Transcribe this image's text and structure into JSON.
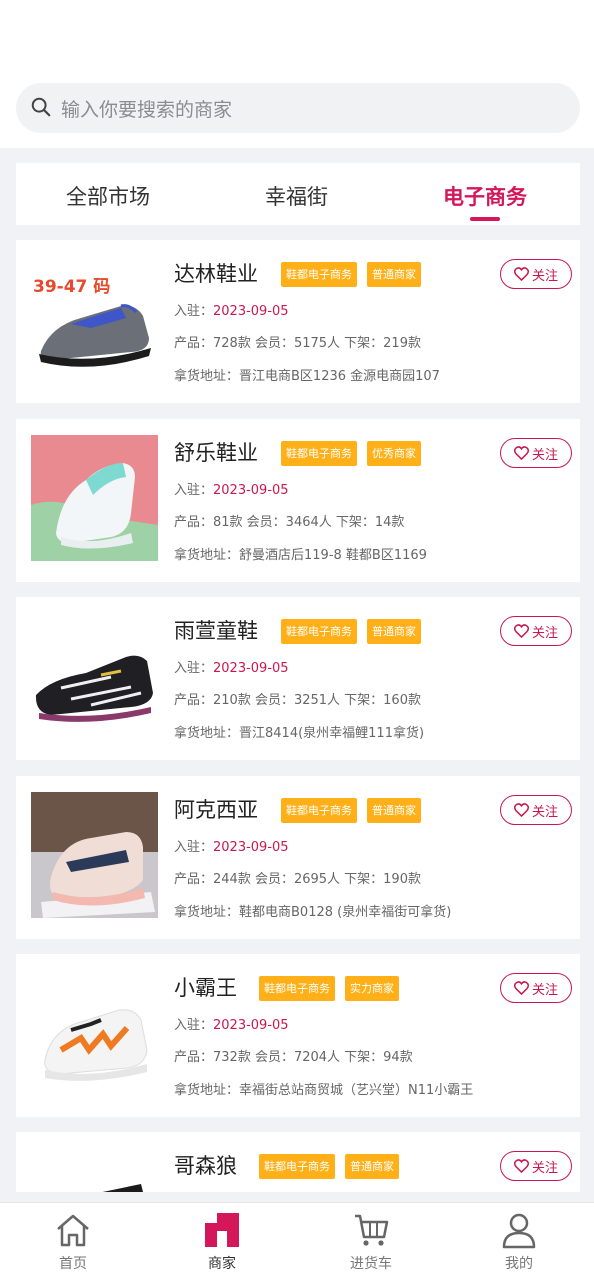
{
  "search": {
    "placeholder": "输入你要搜索的商家"
  },
  "tabs": [
    {
      "label": "全部市场",
      "active": false
    },
    {
      "label": "幸福街",
      "active": false
    },
    {
      "label": "电子商务",
      "active": true
    }
  ],
  "colors": {
    "accent": "#d31759",
    "tag": "#ffb019",
    "page_bg": "#f1f2f6"
  },
  "merchants": [
    {
      "name": "达林鞋业",
      "tags": [
        "鞋都电子商务",
        "普通商家"
      ],
      "follow": "关注",
      "join_label": "入驻：",
      "join_date": "2023-09-05",
      "stats": "产品：728款  会员：5175人  下架：219款",
      "address": "拿货地址：晋江电商B区1236 金源电商园107",
      "image_badge": "39-47 码",
      "image": "sneaker-black-blue"
    },
    {
      "name": "舒乐鞋业",
      "tags": [
        "鞋都电子商务",
        "优秀商家"
      ],
      "follow": "关注",
      "join_label": "入驻：",
      "join_date": "2023-09-05",
      "stats": "产品：81款  会员：3464人  下架：14款",
      "address": "拿货地址：舒曼酒店后119-8 鞋都B区1169",
      "image": "sneaker-white-mint"
    },
    {
      "name": "雨萱童鞋",
      "tags": [
        "鞋都电子商务",
        "普通商家"
      ],
      "follow": "关注",
      "join_label": "入驻：",
      "join_date": "2023-09-05",
      "stats": "产品：210款  会员：3251人  下架：160款",
      "address": "拿货地址：晋江8414(泉州幸福鲤111拿货)",
      "image": "soccer-cleat-black"
    },
    {
      "name": "阿克西亚",
      "tags": [
        "鞋都电子商务",
        "普通商家"
      ],
      "follow": "关注",
      "join_label": "入驻：",
      "join_date": "2023-09-05",
      "stats": "产品：244款  会员：2695人  下架：190款",
      "address": "拿货地址：鞋都电商B0128 (泉州幸福街可拿货)",
      "image": "kids-sneaker-pink"
    },
    {
      "name": "小霸王",
      "tags": [
        "鞋都电子商务",
        "实力商家"
      ],
      "follow": "关注",
      "join_label": "入驻：",
      "join_date": "2023-09-05",
      "stats": "产品：732款  会员：7204人  下架：94款",
      "address": "拿货地址：幸福街总站商贸城（艺兴堂）N11小霸王",
      "image": "kids-sneaker-orange"
    },
    {
      "name": "哥森狼",
      "tags": [
        "鞋都电子商务",
        "普通商家"
      ],
      "follow": "关注",
      "image": "shoe-black"
    }
  ],
  "bottom_nav": [
    {
      "label": "首页",
      "icon": "home-icon",
      "active": false
    },
    {
      "label": "商家",
      "icon": "store-icon",
      "active": true
    },
    {
      "label": "进货车",
      "icon": "cart-icon",
      "active": false
    },
    {
      "label": "我的",
      "icon": "user-icon",
      "active": false
    }
  ]
}
